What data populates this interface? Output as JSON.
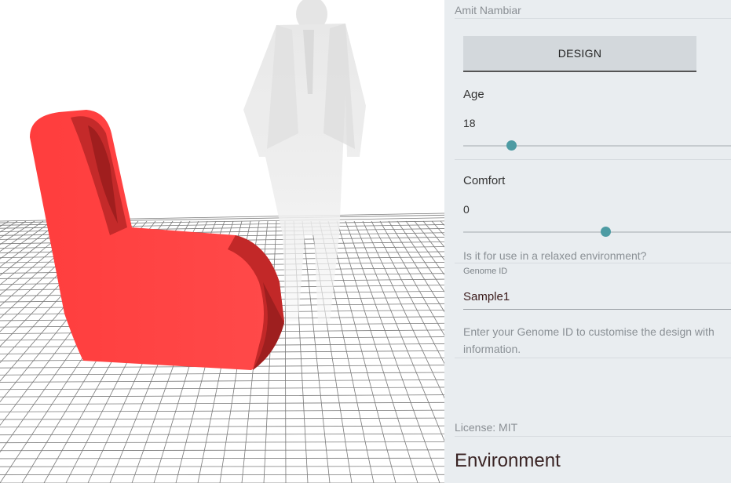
{
  "panel": {
    "author": "Amit Nambiar",
    "design_button": "DESIGN",
    "age": {
      "label": "Age",
      "value": "18",
      "fraction": 0.18
    },
    "comfort": {
      "label": "Comfort",
      "value": "0",
      "fraction": 0.5
    },
    "comfort_hint": "Is it for use in a relaxed environment?",
    "genome": {
      "label": "Genome ID",
      "value": "Sample1",
      "hint": "Enter your Genome ID to customise the design with information."
    },
    "license": "License: MIT",
    "section_title": "Environment"
  },
  "colors": {
    "chair": "#ff4444",
    "chair_shadow": "#a82222",
    "slider_thumb": "#4d9ba3",
    "panel_bg": "#e9edf0"
  }
}
